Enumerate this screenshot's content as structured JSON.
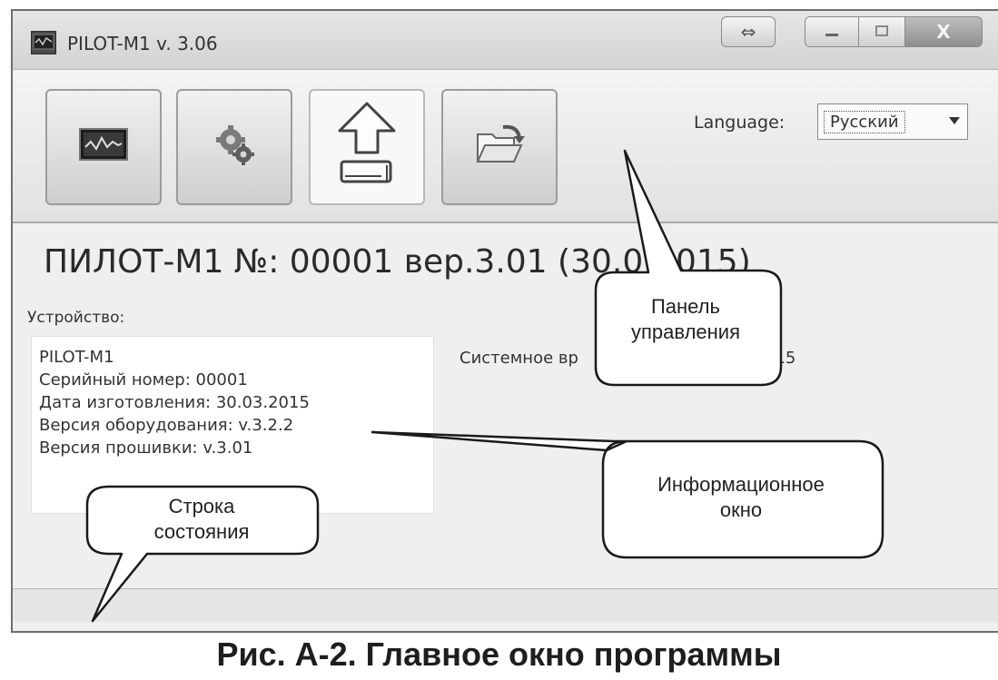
{
  "window": {
    "title": "PILOT-M1 v. 3.06",
    "controls": {
      "close_glyph": "X",
      "resize_glyph": "⇔",
      "minimize_glyph": "—",
      "maximize_glyph": "□"
    }
  },
  "toolbar": {
    "buttons": [
      {
        "icon": "oscilloscope-icon"
      },
      {
        "icon": "gears-icon"
      },
      {
        "icon": "upload-icon"
      },
      {
        "icon": "open-folder-icon"
      }
    ],
    "language_label": "Language:",
    "language_value": "Русский"
  },
  "main": {
    "device_title": "ПИЛОТ-М1 №: 00001 вер.3.01 (30.0",
    "device_title_tail": "015)",
    "device_label": "Устройство:",
    "info_lines": [
      "PILOT-M1",
      "Серийный номер: 00001",
      "Дата изготовления: 30.03.2015",
      "Версия оборудования: v.3.2.2",
      "Версия прошивки: v.3.01"
    ],
    "system_time_label": "Системное вр",
    "system_time_tail": "015"
  },
  "callouts": {
    "control_panel": [
      "Панель",
      "управления"
    ],
    "info_window": [
      "Информационное",
      "окно"
    ],
    "status_bar": [
      "Строка",
      "состояния"
    ]
  },
  "caption": "Рис. А-2. Главное окно программы"
}
